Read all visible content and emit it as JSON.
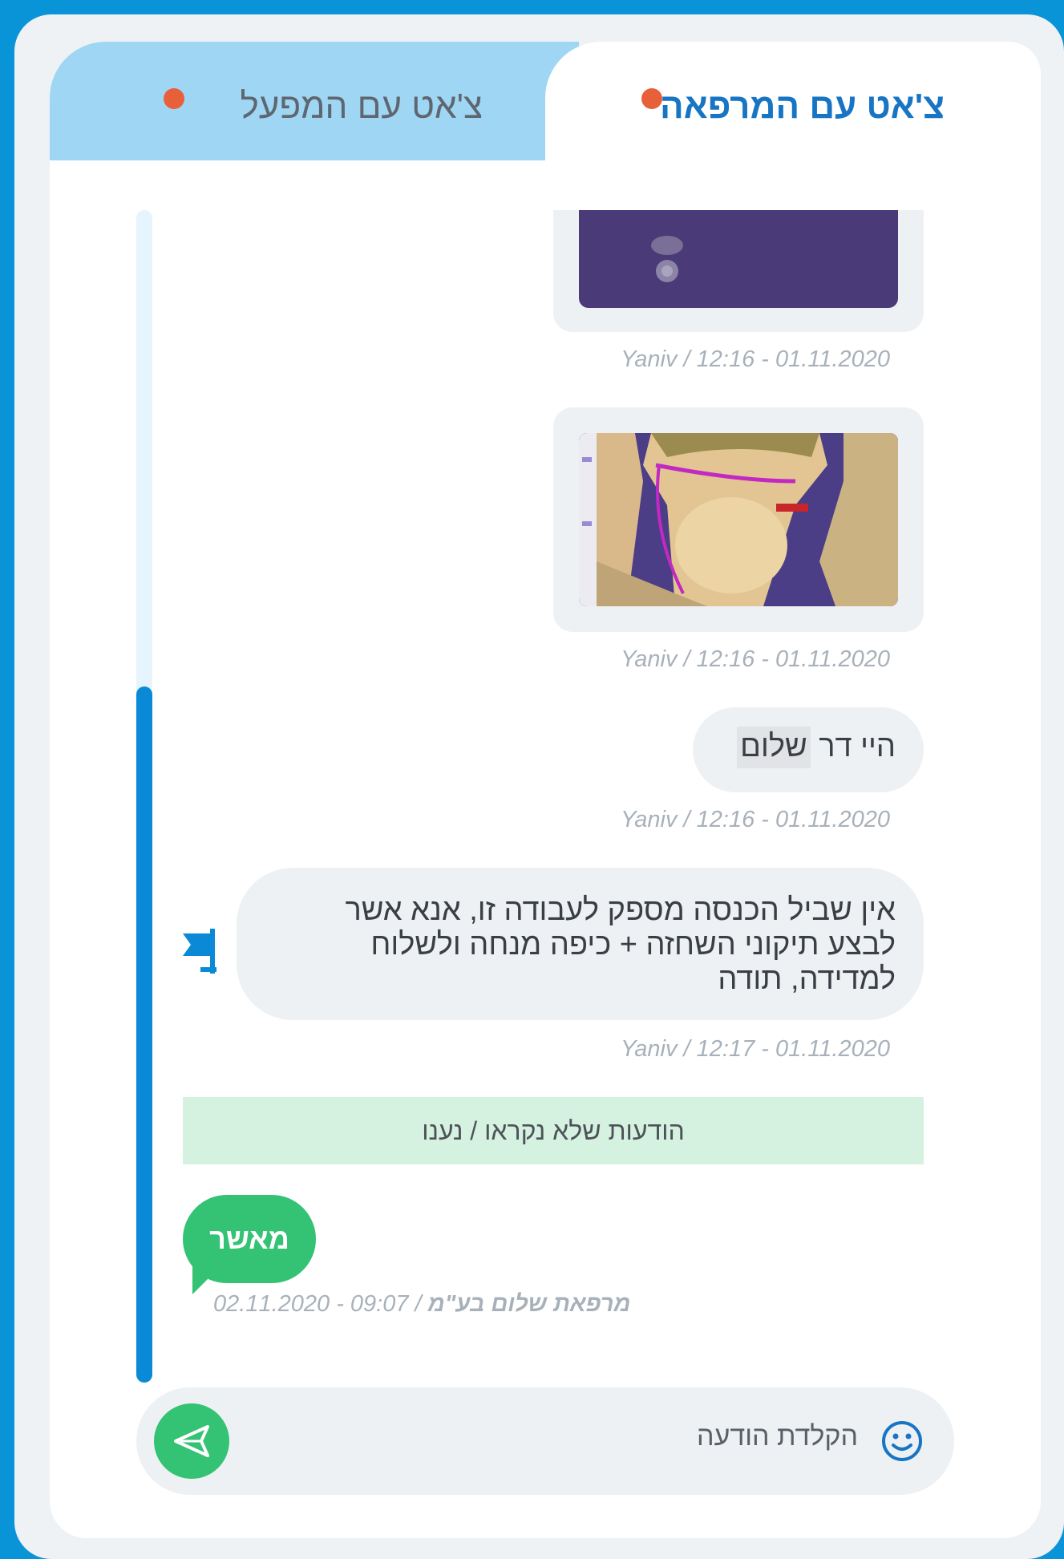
{
  "tabs": {
    "factory": {
      "label": "צ'אט עם המפעל",
      "active": false
    },
    "clinic": {
      "label": "צ'אט עם המרפאה",
      "active": true
    }
  },
  "colors": {
    "accent": "#0a94d8",
    "tab_active_text": "#1775c4",
    "notification_dot": "#e8603a",
    "approve_green": "#34c274",
    "unread_bg": "#d5f2e1"
  },
  "messages": [
    {
      "type": "image",
      "meta": "Yaniv / 12:16 - 01.11.2020"
    },
    {
      "type": "image",
      "meta": "Yaniv / 12:16 - 01.11.2020"
    },
    {
      "type": "text",
      "text_plain": "היי דר ",
      "text_highlight": "שלום",
      "meta": "Yaniv / 12:16 - 01.11.2020"
    },
    {
      "type": "text",
      "lines": [
        "אין שביל הכנסה מספק לעבודה זו, אנא אשר",
        "לבצע תיקוני השחזה + כיפה מנחה ולשלוח",
        "למדידה, תודה"
      ],
      "meta": "Yaniv / 12:17 - 01.11.2020"
    }
  ],
  "unread_divider": "הודעות שלא נקראו / נענו",
  "reply": {
    "text": "מאשר",
    "meta_date": "02.11.2020 - 09:07 /",
    "meta_author": "מרפאת שלום בע\"מ"
  },
  "input": {
    "placeholder": "הקלדת הודעה"
  },
  "icons": {
    "send": "send-icon",
    "emoji": "smiley-icon",
    "flag": "flag-icon"
  }
}
